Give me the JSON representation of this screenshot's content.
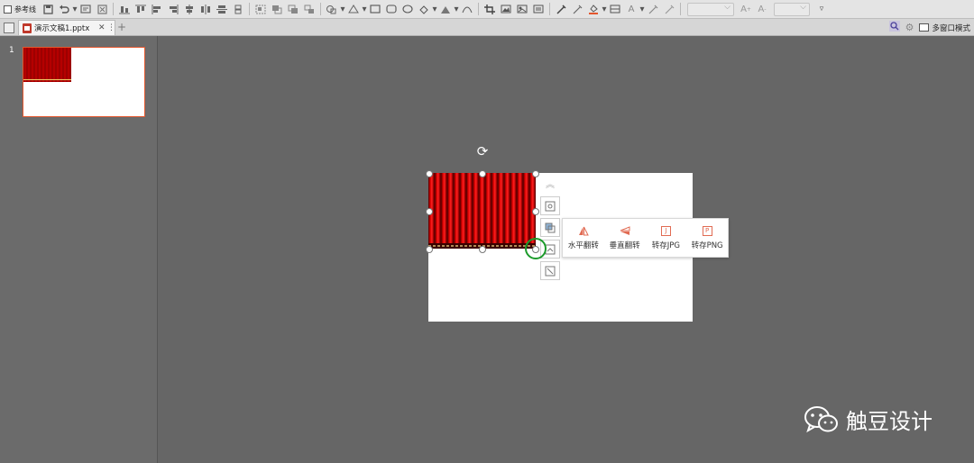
{
  "toolbar": {
    "guides_label": "参考线",
    "icons": [
      "save-icon",
      "undo-icon",
      "text-box-icon",
      "close-box-icon",
      "align-bottom-icon",
      "align-top-icon",
      "align-left-icon",
      "align-right-icon",
      "align-center-icon",
      "distribute-horizontal-icon",
      "distribute-vertical-icon",
      "align-middle-icon",
      "group-icon",
      "bring-front-icon",
      "send-back-icon",
      "layer-icon",
      "shapes-icon",
      "shape-style-icon",
      "rectangle-icon",
      "rounded-rectangle-icon",
      "ellipse-icon",
      "shape-fill-icon",
      "triangle-icon",
      "curve-icon",
      "crop-icon",
      "picture-icon",
      "image-adjust-icon",
      "text-box-alt-icon",
      "eyedropper-icon",
      "eyedropper-alt-icon",
      "fill-color-icon",
      "text-box-grid-icon",
      "font-color-icon",
      "pen-icon",
      "pen-alt-icon",
      "font-grow-icon",
      "font-shrink-icon",
      "more-icon"
    ]
  },
  "tabs": [
    {
      "label": "演示文稿1.pptx"
    }
  ],
  "right_controls": {
    "multi_window_label": "多窗口模式"
  },
  "slide_panel": {
    "slide_number": "1"
  },
  "context_popup": {
    "items": [
      {
        "label": "水平翻转",
        "icon": "flip-horizontal-icon"
      },
      {
        "label": "垂直翻转",
        "icon": "flip-vertical-icon"
      },
      {
        "label": "转存JPG",
        "icon": "save-jpg-icon",
        "glyph": "J"
      },
      {
        "label": "转存PNG",
        "icon": "save-png-icon",
        "glyph": "P"
      }
    ]
  },
  "watermark": {
    "text": "触豆设计"
  },
  "colors": {
    "accent": "#e4572e",
    "highlight": "#1c9b2b",
    "curtain": "#c50000"
  }
}
